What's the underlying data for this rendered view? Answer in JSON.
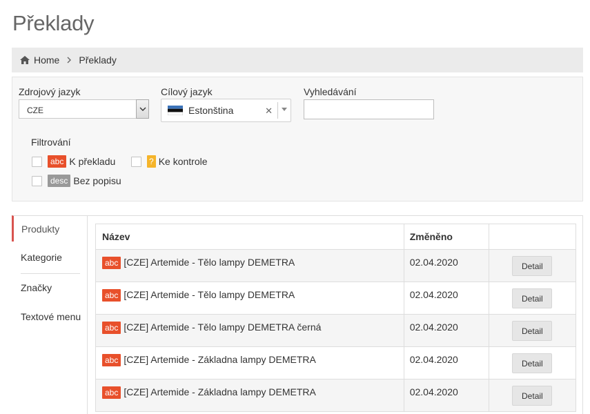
{
  "page_title": "Překlady",
  "breadcrumb": {
    "home_label": "Home",
    "current_label": "Překlady"
  },
  "filters": {
    "source_language_label": "Zdrojový jazyk",
    "source_language_value": "CZE",
    "target_language_label": "Cílový jazyk",
    "target_language_value": "Estonština",
    "target_language_flag": "estonia-flag",
    "search_label": "Vyhledávání",
    "search_value": "",
    "filtering_label": "Filtrování",
    "options": [
      {
        "badge": "abc",
        "label": "K překladu",
        "checked": false
      },
      {
        "badge": "?",
        "label": "Ke kontrole",
        "checked": false
      },
      {
        "badge": "desc",
        "label": "Bez popisu",
        "checked": false
      }
    ]
  },
  "tabs": [
    {
      "label": "Produkty",
      "active": true
    },
    {
      "label": "Kategorie",
      "active": false
    },
    {
      "label": "Značky",
      "active": false
    },
    {
      "label": "Textové menu",
      "active": false
    }
  ],
  "table": {
    "columns": [
      "Název",
      "Změněno",
      ""
    ],
    "badge_label": "abc",
    "detail_label": "Detail",
    "rows": [
      {
        "name": "[CZE] Artemide - Tělo lampy DEMETRA",
        "changed": "02.04.2020"
      },
      {
        "name": "[CZE] Artemide - Tělo lampy DEMETRA",
        "changed": "02.04.2020"
      },
      {
        "name": "[CZE] Artemide - Tělo lampy DEMETRA černá",
        "changed": "02.04.2020"
      },
      {
        "name": "[CZE] Artemide - Základna lampy DEMETRA",
        "changed": "02.04.2020"
      },
      {
        "name": "[CZE] Artemide - Základna lampy DEMETRA",
        "changed": "02.04.2020"
      }
    ]
  },
  "colors": {
    "badge_abc": "#e8502b",
    "badge_desc": "#999999",
    "badge_check": "#f5b42a",
    "active_tab_accent": "#d9534f"
  }
}
